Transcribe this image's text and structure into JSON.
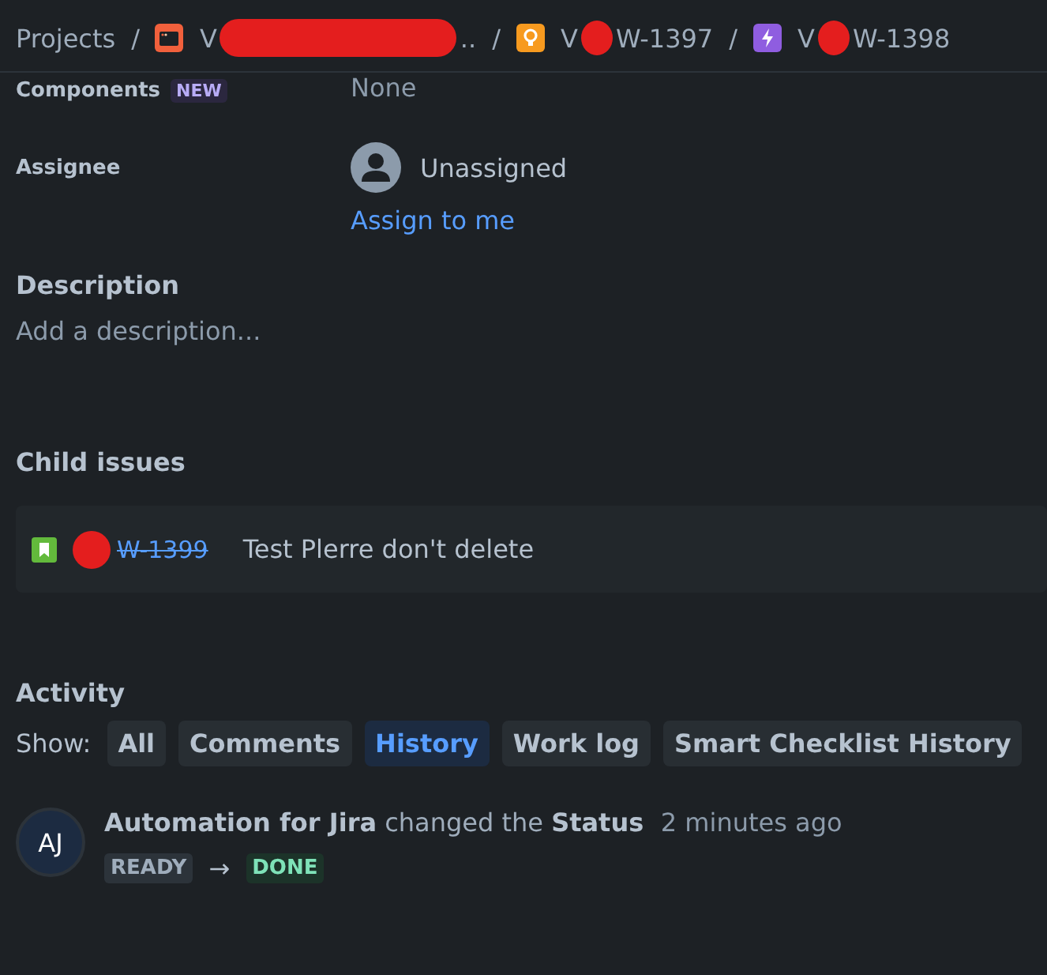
{
  "breadcrumbs": [
    {
      "kind": "text",
      "text": "Projects"
    },
    {
      "kind": "project",
      "separator": "/",
      "prefix": "V",
      "text": ".."
    },
    {
      "kind": "idea",
      "separator": "/",
      "prefix": "V",
      "text": "W-1397"
    },
    {
      "kind": "epic",
      "separator": "/",
      "prefix": "V",
      "text": "W-1398"
    }
  ],
  "fields": [
    {
      "label": "Components",
      "badge": "NEW",
      "value": "None"
    },
    {
      "label": "Assignee",
      "value": "Unassigned",
      "action": "Assign to me"
    }
  ],
  "description": {
    "title": "Description",
    "placeholder": "Add a description..."
  },
  "child_issues": {
    "title": "Child issues",
    "items": [
      {
        "key": "W-1399",
        "done": true,
        "summary": "Test Plerre don't delete"
      }
    ]
  },
  "activity": {
    "title": "Activity",
    "show_label": "Show:",
    "filters": [
      {
        "label": "All",
        "selected": false
      },
      {
        "label": "Comments",
        "selected": false
      },
      {
        "label": "History",
        "selected": true
      },
      {
        "label": "Work log",
        "selected": false
      },
      {
        "label": "Smart Checklist History",
        "selected": false
      }
    ],
    "entries": [
      {
        "avatar": "AJ",
        "author": "Automation for Jira",
        "action": "changed the",
        "field": "Status",
        "time": "2 minutes ago",
        "from": "READY",
        "arrow": "→",
        "to": "DONE"
      }
    ]
  }
}
